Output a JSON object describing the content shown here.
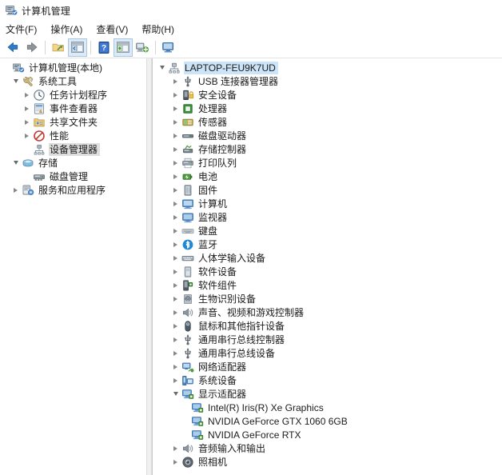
{
  "window": {
    "title": "计算机管理",
    "icon": "computer-management-icon"
  },
  "menubar": {
    "items": [
      {
        "label": "文件(F)",
        "name": "menu-file"
      },
      {
        "label": "操作(A)",
        "name": "menu-action"
      },
      {
        "label": "查看(V)",
        "name": "menu-view"
      },
      {
        "label": "帮助(H)",
        "name": "menu-help"
      }
    ]
  },
  "toolbar": {
    "buttons": [
      {
        "name": "back-button",
        "icon": "arrow-left-icon",
        "title": "后退"
      },
      {
        "name": "forward-button",
        "icon": "arrow-right-icon",
        "title": "前进"
      },
      {
        "name": "up-folder-button",
        "icon": "folder-up-icon",
        "title": "上移一级"
      },
      {
        "name": "show-hide-tree-button",
        "icon": "console-tree-icon",
        "title": "显示/隐藏控制台树"
      },
      {
        "name": "help-button",
        "icon": "help-icon",
        "title": "帮助"
      },
      {
        "name": "properties-button",
        "icon": "properties-icon",
        "title": "属性"
      },
      {
        "name": "scan-hardware-button",
        "icon": "scan-hardware-icon",
        "title": "扫描检测硬件改动"
      },
      {
        "name": "update-driver-button",
        "icon": "monitor-icon",
        "title": "更新驱动程序"
      }
    ]
  },
  "tree": {
    "root": {
      "label": "计算机管理(本地)",
      "icon": "computer-management-icon",
      "expanded": true,
      "indent": 0,
      "twisty": "none"
    },
    "items": [
      {
        "label": "系统工具",
        "icon": "system-tools-icon",
        "indent": 1,
        "twisty": "down",
        "selected": false
      },
      {
        "label": "任务计划程序",
        "icon": "task-scheduler-icon",
        "indent": 2,
        "twisty": "right",
        "selected": false
      },
      {
        "label": "事件查看器",
        "icon": "event-viewer-icon",
        "indent": 2,
        "twisty": "right",
        "selected": false
      },
      {
        "label": "共享文件夹",
        "icon": "shared-folders-icon",
        "indent": 2,
        "twisty": "right",
        "selected": false
      },
      {
        "label": "性能",
        "icon": "performance-icon",
        "indent": 2,
        "twisty": "right",
        "selected": false
      },
      {
        "label": "设备管理器",
        "icon": "device-manager-icon",
        "indent": 2,
        "twisty": "none",
        "selected": true
      },
      {
        "label": "存储",
        "icon": "storage-icon",
        "indent": 1,
        "twisty": "down",
        "selected": false
      },
      {
        "label": "磁盘管理",
        "icon": "disk-management-icon",
        "indent": 2,
        "twisty": "none",
        "selected": false
      },
      {
        "label": "服务和应用程序",
        "icon": "services-applications-icon",
        "indent": 1,
        "twisty": "right",
        "selected": false
      }
    ]
  },
  "devices": {
    "root": {
      "label": "LAPTOP-FEU9K7UD",
      "icon": "computer-node-icon",
      "twisty": "down",
      "selected": true,
      "indent": 0
    },
    "items": [
      {
        "label": "USB 连接器管理器",
        "icon": "usb-icon",
        "twisty": "right",
        "indent": 1
      },
      {
        "label": "安全设备",
        "icon": "security-device-icon",
        "twisty": "right",
        "indent": 1
      },
      {
        "label": "处理器",
        "icon": "processor-icon",
        "twisty": "right",
        "indent": 1
      },
      {
        "label": "传感器",
        "icon": "sensor-icon",
        "twisty": "right",
        "indent": 1
      },
      {
        "label": "磁盘驱动器",
        "icon": "disk-drive-icon",
        "twisty": "right",
        "indent": 1
      },
      {
        "label": "存储控制器",
        "icon": "storage-controller-icon",
        "twisty": "right",
        "indent": 1
      },
      {
        "label": "打印队列",
        "icon": "print-queue-icon",
        "twisty": "right",
        "indent": 1
      },
      {
        "label": "电池",
        "icon": "battery-icon",
        "twisty": "right",
        "indent": 1
      },
      {
        "label": "固件",
        "icon": "firmware-icon",
        "twisty": "right",
        "indent": 1
      },
      {
        "label": "计算机",
        "icon": "computer-icon",
        "twisty": "right",
        "indent": 1
      },
      {
        "label": "监视器",
        "icon": "monitor-device-icon",
        "twisty": "right",
        "indent": 1
      },
      {
        "label": "键盘",
        "icon": "keyboard-icon",
        "twisty": "right",
        "indent": 1
      },
      {
        "label": "蓝牙",
        "icon": "bluetooth-icon",
        "twisty": "right",
        "indent": 1
      },
      {
        "label": "人体学输入设备",
        "icon": "hid-icon",
        "twisty": "right",
        "indent": 1
      },
      {
        "label": "软件设备",
        "icon": "software-device-icon",
        "twisty": "right",
        "indent": 1
      },
      {
        "label": "软件组件",
        "icon": "software-component-icon",
        "twisty": "right",
        "indent": 1
      },
      {
        "label": "生物识别设备",
        "icon": "biometric-icon",
        "twisty": "right",
        "indent": 1
      },
      {
        "label": "声音、视频和游戏控制器",
        "icon": "sound-video-game-icon",
        "twisty": "right",
        "indent": 1
      },
      {
        "label": "鼠标和其他指针设备",
        "icon": "mouse-icon",
        "twisty": "right",
        "indent": 1
      },
      {
        "label": "通用串行总线控制器",
        "icon": "usb-controller-icon",
        "twisty": "right",
        "indent": 1
      },
      {
        "label": "通用串行总线设备",
        "icon": "usb-device-icon",
        "twisty": "right",
        "indent": 1
      },
      {
        "label": "网络适配器",
        "icon": "network-adapter-icon",
        "twisty": "right",
        "indent": 1
      },
      {
        "label": "系统设备",
        "icon": "system-device-icon",
        "twisty": "right",
        "indent": 1
      },
      {
        "label": "显示适配器",
        "icon": "display-adapter-icon",
        "twisty": "down",
        "indent": 1
      },
      {
        "label": "Intel(R) Iris(R) Xe Graphics",
        "icon": "display-adapter-child-icon",
        "twisty": "none",
        "indent": 2
      },
      {
        "label": "NVIDIA GeForce GTX 1060 6GB",
        "icon": "display-adapter-child-icon",
        "twisty": "none",
        "indent": 2
      },
      {
        "label": "NVIDIA GeForce RTX",
        "icon": "display-adapter-child-icon",
        "twisty": "none",
        "indent": 2
      },
      {
        "label": "音频输入和输出",
        "icon": "audio-io-icon",
        "twisty": "right",
        "indent": 1
      },
      {
        "label": "照相机",
        "icon": "camera-icon",
        "twisty": "right",
        "indent": 1
      }
    ]
  },
  "colors": {
    "selection_blue": "#cce4f7",
    "selection_gray": "#dedede",
    "window_bg": "#ffffff",
    "splitter": "#f0f0f0"
  }
}
